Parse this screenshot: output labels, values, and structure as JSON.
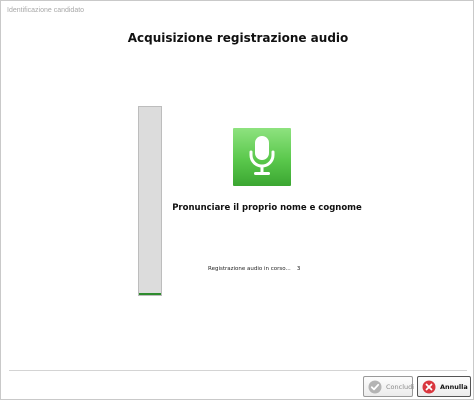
{
  "window": {
    "title": "Identificazione candidato"
  },
  "main": {
    "heading": "Acquisizione registrazione audio",
    "instruction": "Pronunciare il proprio nome e cognome",
    "status_text": "Registrazione audio in corso...",
    "status_count": "3",
    "audio_level": 0.01,
    "mic_icon": "microphone-icon"
  },
  "footer": {
    "conclude_label": "Concludi",
    "cancel_label": "Annulla"
  },
  "colors": {
    "accent_green": "#4cbf3e",
    "cancel_red": "#d9363e",
    "meter_fill": "#2e8b2e"
  }
}
